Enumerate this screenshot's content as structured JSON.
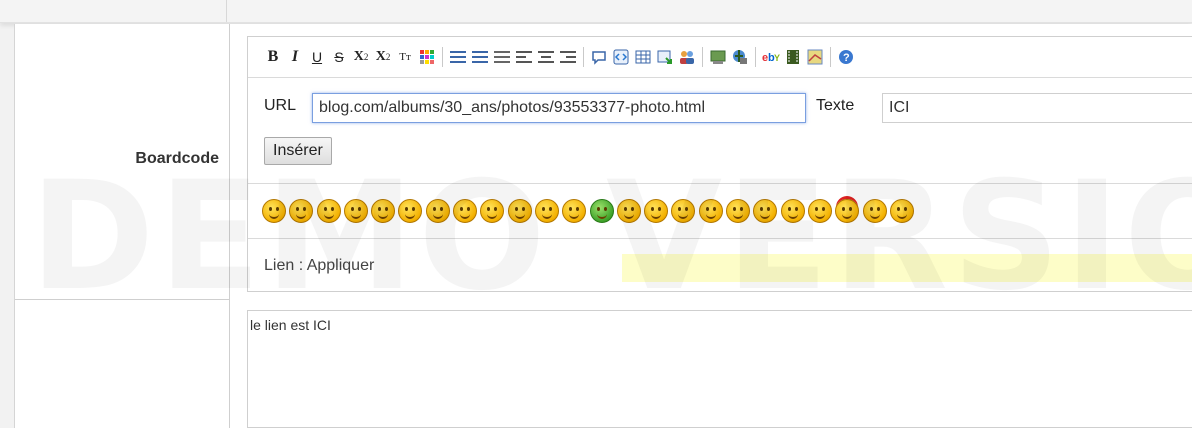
{
  "field": {
    "label": "Boardcode"
  },
  "toolbar": {
    "bold": "B",
    "italic": "I",
    "underline": "U",
    "strike": "S",
    "sub": "X",
    "sub_small": "2",
    "sup": "X",
    "sup_small": "2",
    "font": "Tт"
  },
  "url_bar": {
    "url_label": "URL",
    "url_value": "blog.com/albums/30_ans/photos/93553377-photo.html",
    "text_label": "Texte",
    "text_value": "ICI",
    "insert_button": "Insérer"
  },
  "status": {
    "text": "Lien : Appliquer"
  },
  "content": {
    "text": "le lien est ICI"
  },
  "watermark": {
    "text": "DEMO VERSION"
  },
  "colors": {
    "accent": "#7a9fe0",
    "highlight": "#fdfdc8"
  },
  "smileys_count_label": ""
}
